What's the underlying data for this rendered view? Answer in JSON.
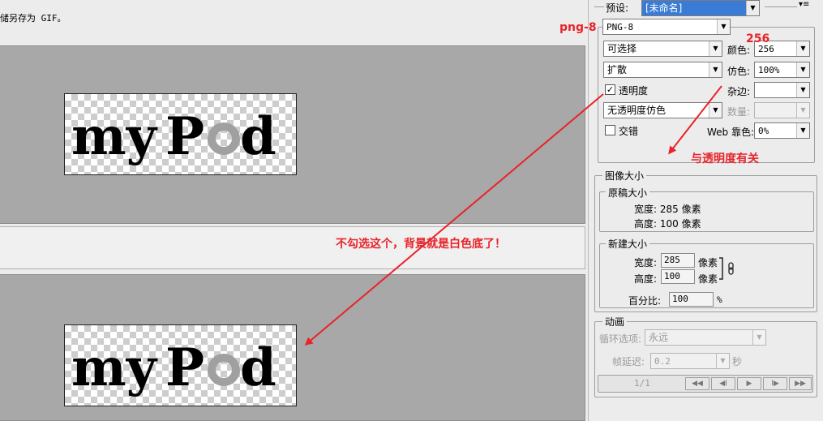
{
  "left": {
    "top_note": "储另存为 GIF。",
    "logo_text_a": "my",
    "logo_text_b": "P",
    "logo_text_c": "d"
  },
  "panel": {
    "preset_label": "预设:",
    "preset_value": "[未命名]",
    "format_value": "PNG-8",
    "reduction_value": "可选择",
    "colors_label": "颜色:",
    "colors_value": "256",
    "dither_algo_value": "扩散",
    "dither_label": "仿色:",
    "dither_value": "100%",
    "transparency_label": "透明度",
    "transparency_checked": "✓",
    "matte_label": "杂边:",
    "matte_value": "",
    "trans_dither_value": "无透明度仿色",
    "amount_label": "数量:",
    "amount_value": "",
    "interlace_label": "交错",
    "web_snap_label": "Web 靠色:",
    "web_snap_value": "0%"
  },
  "image_size": {
    "title": "图像大小",
    "original_title": "原稿大小",
    "orig_width": "宽度: 285 像素",
    "orig_height": "高度: 100 像素",
    "new_title": "新建大小",
    "width_label": "宽度:",
    "width_value": "285",
    "height_label": "高度:",
    "height_value": "100",
    "unit": "像素",
    "percent_label": "百分比:",
    "percent_value": "100",
    "percent_unit": "%"
  },
  "animation": {
    "title": "动画",
    "loop_label": "循环选项:",
    "loop_value": "永远",
    "delay_label": "帧延迟:",
    "delay_value": "0.2",
    "delay_unit": "秒",
    "frame_counter": "1/1",
    "btn_first": "◀◀",
    "btn_prev": "◀I",
    "btn_play": "▶",
    "btn_next": "I▶",
    "btn_last": "▶▶"
  },
  "annotations": {
    "png8": "png-8",
    "n256": "256",
    "related": "与透明度有关",
    "unchecked": "不勾选这个，背景就是白色底了！"
  },
  "colors": {
    "annotation": "#e8232a",
    "selected": "#3a7bd5"
  }
}
